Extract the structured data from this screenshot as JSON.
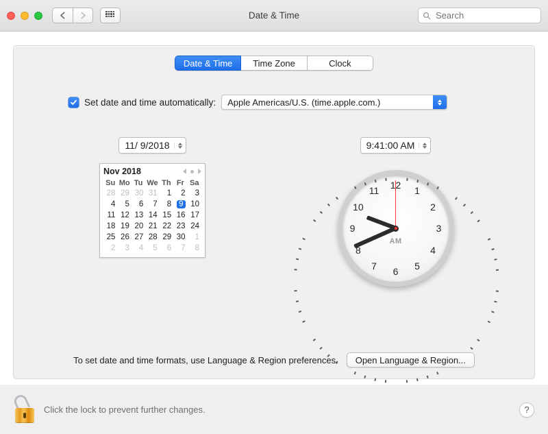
{
  "title": "Date & Time",
  "search": {
    "placeholder": "Search"
  },
  "tabs": [
    {
      "label": "Date & Time",
      "active": true
    },
    {
      "label": "Time Zone",
      "active": false
    },
    {
      "label": "Clock",
      "active": false
    }
  ],
  "auto": {
    "checked": true,
    "label": "Set date and time automatically:",
    "server": "Apple Americas/U.S. (time.apple.com.)"
  },
  "date_field": "11/  9/2018",
  "time_field": "9:41:00 AM",
  "calendar": {
    "title": "Nov 2018",
    "weekdays": [
      "Su",
      "Mo",
      "Tu",
      "We",
      "Th",
      "Fr",
      "Sa"
    ],
    "weeks": [
      [
        {
          "d": 28,
          "out": true
        },
        {
          "d": 29,
          "out": true
        },
        {
          "d": 30,
          "out": true
        },
        {
          "d": 31,
          "out": true
        },
        {
          "d": 1
        },
        {
          "d": 2
        },
        {
          "d": 3
        }
      ],
      [
        {
          "d": 4
        },
        {
          "d": 5
        },
        {
          "d": 6
        },
        {
          "d": 7
        },
        {
          "d": 8
        },
        {
          "d": 9,
          "sel": true
        },
        {
          "d": 10
        }
      ],
      [
        {
          "d": 11
        },
        {
          "d": 12
        },
        {
          "d": 13
        },
        {
          "d": 14
        },
        {
          "d": 15
        },
        {
          "d": 16
        },
        {
          "d": 17
        }
      ],
      [
        {
          "d": 18
        },
        {
          "d": 19
        },
        {
          "d": 20
        },
        {
          "d": 21
        },
        {
          "d": 22
        },
        {
          "d": 23
        },
        {
          "d": 24
        }
      ],
      [
        {
          "d": 25
        },
        {
          "d": 26
        },
        {
          "d": 27
        },
        {
          "d": 28
        },
        {
          "d": 29
        },
        {
          "d": 30
        },
        {
          "d": 1,
          "out": true
        }
      ],
      [
        {
          "d": 2,
          "out": true
        },
        {
          "d": 3,
          "out": true
        },
        {
          "d": 4,
          "out": true
        },
        {
          "d": 5,
          "out": true
        },
        {
          "d": 6,
          "out": true
        },
        {
          "d": 7,
          "out": true
        },
        {
          "d": 8,
          "out": true
        }
      ]
    ]
  },
  "clock": {
    "hours": 9,
    "minutes": 41,
    "seconds": 0,
    "ampm": "AM"
  },
  "hint": "To set date and time formats, use Language & Region preferences.",
  "open_lang_region": "Open Language & Region...",
  "lock_text": "Click the lock to prevent further changes.",
  "help": "?"
}
